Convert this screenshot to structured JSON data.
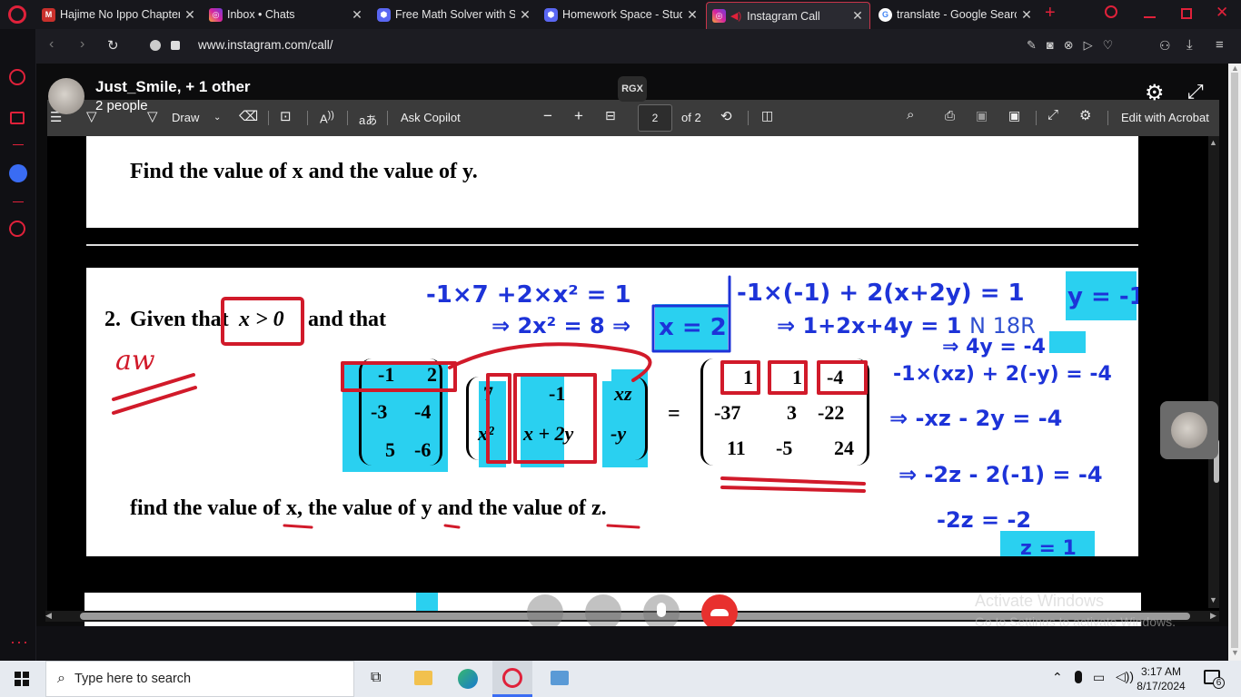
{
  "browser": {
    "tabs": [
      {
        "title": "Hajime No Ippo Chapter",
        "favicon": "manga-icon"
      },
      {
        "title": "Inbox • Chats",
        "favicon": "instagram-icon"
      },
      {
        "title": "Free Math Solver with St",
        "favicon": "studyx-icon"
      },
      {
        "title": "Homework Space - Stud",
        "favicon": "studyx-icon"
      },
      {
        "title": "Instagram Call",
        "favicon": "instagram-icon",
        "active": true
      },
      {
        "title": "translate - Google Search",
        "favicon": "google-icon"
      }
    ],
    "new_tab": "+",
    "url": "www.instagram.com/call/"
  },
  "call": {
    "name": "Just_Smile, + 1 other",
    "participants": "2 people",
    "badge": "RGX"
  },
  "pdf_toolbar": {
    "draw": "Draw",
    "ask_copilot": "Ask Copilot",
    "page_current": "2",
    "page_total": "of 2",
    "edit_acrobat": "Edit with Acrobat"
  },
  "document": {
    "q1_text": "Find the value of x and the value of y.",
    "q2_number": "2.",
    "q2_given": "Given that",
    "q2_condition": "x > 0",
    "q2_and": "and that",
    "q2_footer": "find the value of x, the value of y and the value of z.",
    "matrix_a": [
      [
        "-1",
        "2"
      ],
      [
        "-3",
        "-4"
      ],
      [
        "5",
        "-6"
      ]
    ],
    "matrix_b": [
      [
        "7",
        "-1",
        "xz"
      ],
      [
        "x²",
        "x + 2y",
        "-y"
      ]
    ],
    "matrix_c": [
      [
        "1",
        "1",
        "-4"
      ],
      [
        "-37",
        "3",
        "-22"
      ],
      [
        "11",
        "-5",
        "24"
      ]
    ],
    "equals": "="
  },
  "annotations": {
    "aw": "aw",
    "line1": "-1×7 +2×x² = 1",
    "line2": "⇒ 2x² = 8 ⇒",
    "x_result": "x = 2",
    "line3": "-1×(-1) + 2(x+2y) = 1",
    "line4": "⇒ 1+2x+4y = 1",
    "line5": "⇒ 4y = -4",
    "y_result": "y = -1",
    "line6": "-1×(xz) + 2(-y) = -4",
    "line7": "⇒ -xz - 2y = -4",
    "line8": "⇒ -2z - 2(-1) = -4",
    "line9": "-2z = -2",
    "z_result": "z = 1",
    "watermark": "N 18R"
  },
  "overlay": {
    "activate_title": "Activate Windows",
    "activate_sub": "Go to Settings to activate Windows."
  },
  "taskbar": {
    "search_placeholder": "Type here to search",
    "time": "3:17 AM",
    "date": "8/17/2024",
    "notifications": "6"
  },
  "colors": {
    "highlight": "#2ad0f0",
    "annotation_blue": "#1d33d8",
    "annotation_red": "#d11a2a",
    "end_call": "#e8302e",
    "opera_red": "#e0213a"
  }
}
